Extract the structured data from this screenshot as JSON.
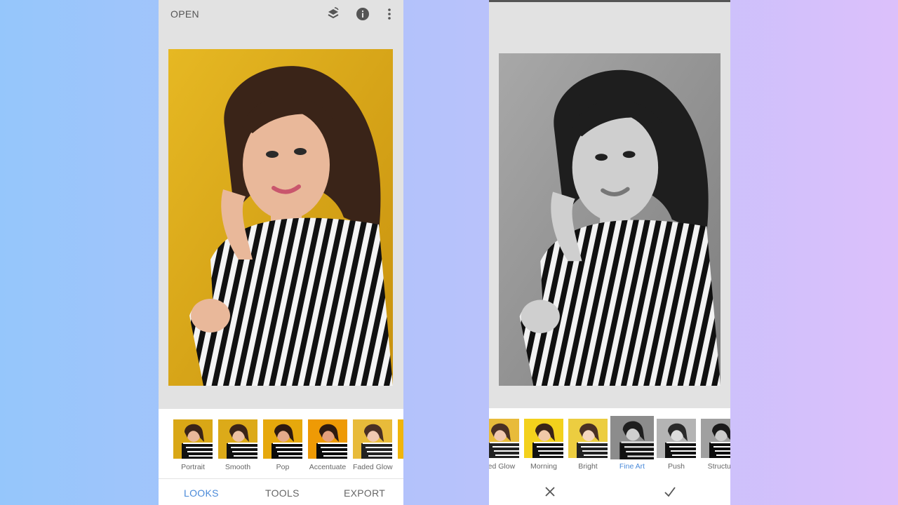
{
  "left_screen": {
    "topbar": {
      "open_label": "OPEN",
      "icons": [
        "layers-stack-icon",
        "info-icon",
        "more-vert-icon"
      ]
    },
    "looks": [
      {
        "label": "Portrait",
        "variant": "color"
      },
      {
        "label": "Smooth",
        "variant": "color"
      },
      {
        "label": "Pop",
        "variant": "color"
      },
      {
        "label": "Accentuate",
        "variant": "color"
      },
      {
        "label": "Faded Glow",
        "variant": "color"
      }
    ],
    "nav": {
      "looks": "LOOKS",
      "tools": "TOOLS",
      "export": "EXPORT",
      "active": "LOOKS"
    }
  },
  "right_screen": {
    "looks": [
      {
        "label": "ded Glow",
        "variant": "color"
      },
      {
        "label": "Morning",
        "variant": "color"
      },
      {
        "label": "Bright",
        "variant": "color"
      },
      {
        "label": "Fine Art",
        "variant": "bw",
        "selected": true
      },
      {
        "label": "Push",
        "variant": "bw"
      },
      {
        "label": "Structur",
        "variant": "bw"
      }
    ],
    "actions": [
      "close-icon",
      "checkmark-icon"
    ]
  },
  "colors": {
    "accent": "#4a8ad9",
    "photo_background_color": "#e0b21d",
    "photo_background_bw": "#9a9a9a",
    "app_background": "#e2e2e2"
  }
}
